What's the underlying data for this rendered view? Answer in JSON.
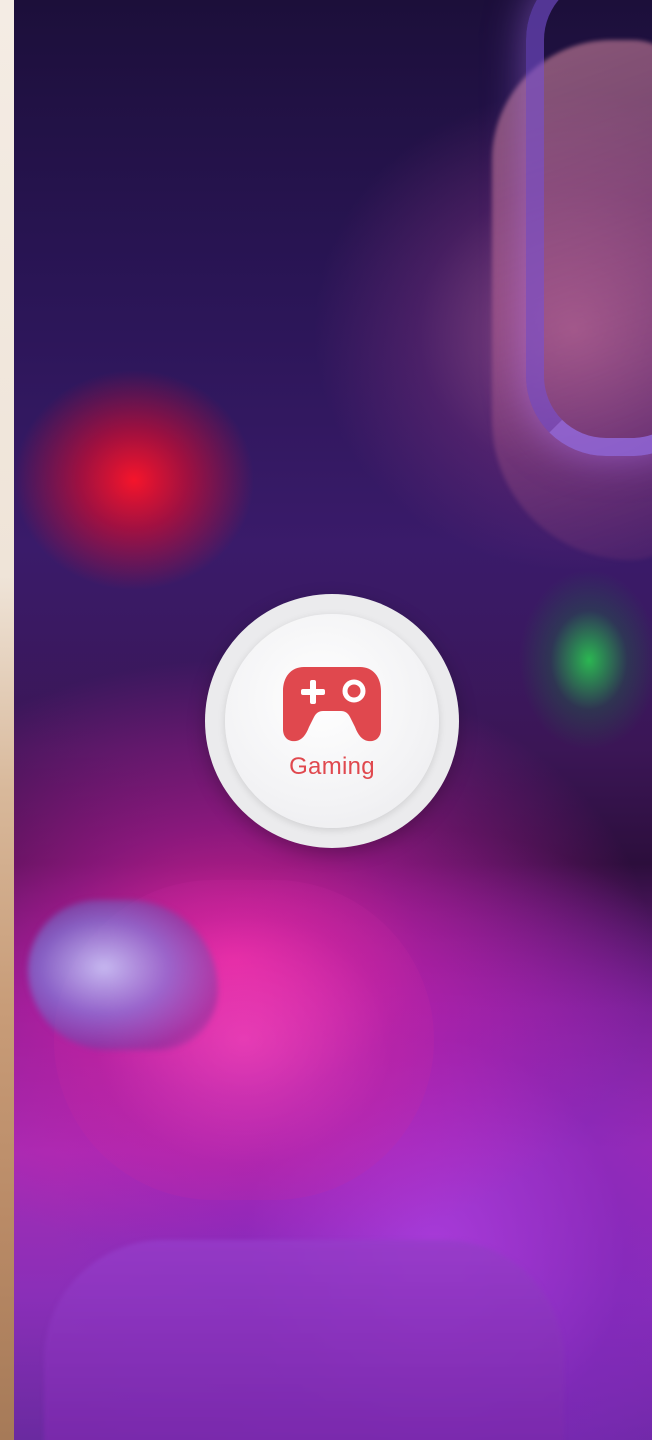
{
  "card": {
    "category_label": "Gaming",
    "icon": "gamepad-icon",
    "accent_color": "#e0484e"
  }
}
